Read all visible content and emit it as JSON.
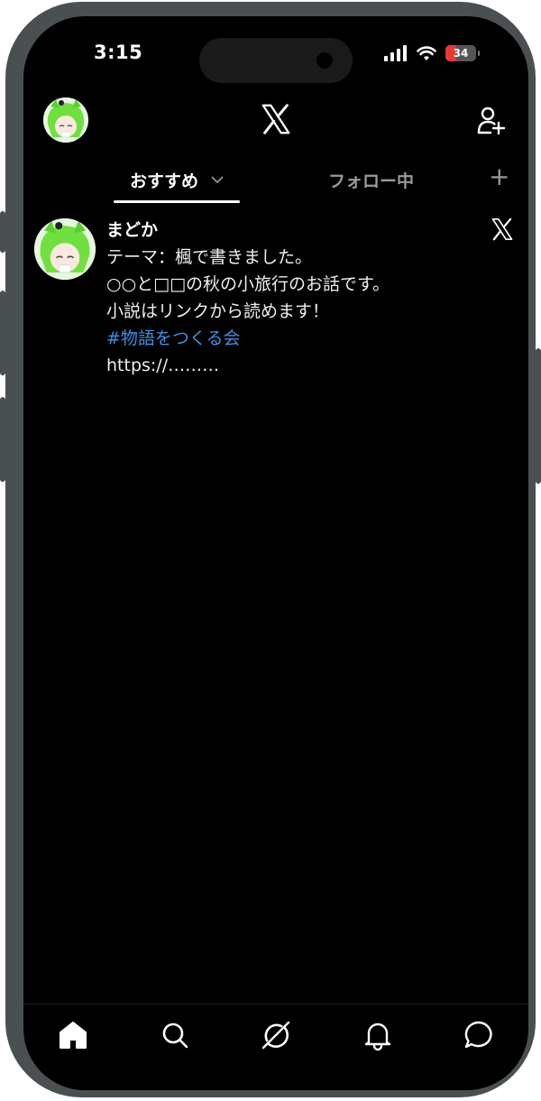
{
  "status_bar": {
    "time": "3:15",
    "battery": "34"
  },
  "header": {
    "logo_icon": "x-logo-icon",
    "follow_icon": "add-person-icon"
  },
  "tabs": {
    "recommended": "おすすめ",
    "following": "フォロー中",
    "add": "+"
  },
  "post": {
    "author": "まどか",
    "lines": [
      "テーマ：楓で書きました。",
      "○○と□□の秋の小旅行のお話です。",
      "小説はリンクから読めます！"
    ],
    "hashtag": "#物語をつくる会",
    "link": "https://………"
  },
  "bottom_nav": [
    "home-icon",
    "search-icon",
    "grok-icon",
    "bell-icon",
    "message-icon"
  ],
  "colors": {
    "frame": "#4a5052",
    "background": "#000000",
    "accent": "#3d8fe6",
    "muted": "#9a9a9a"
  }
}
